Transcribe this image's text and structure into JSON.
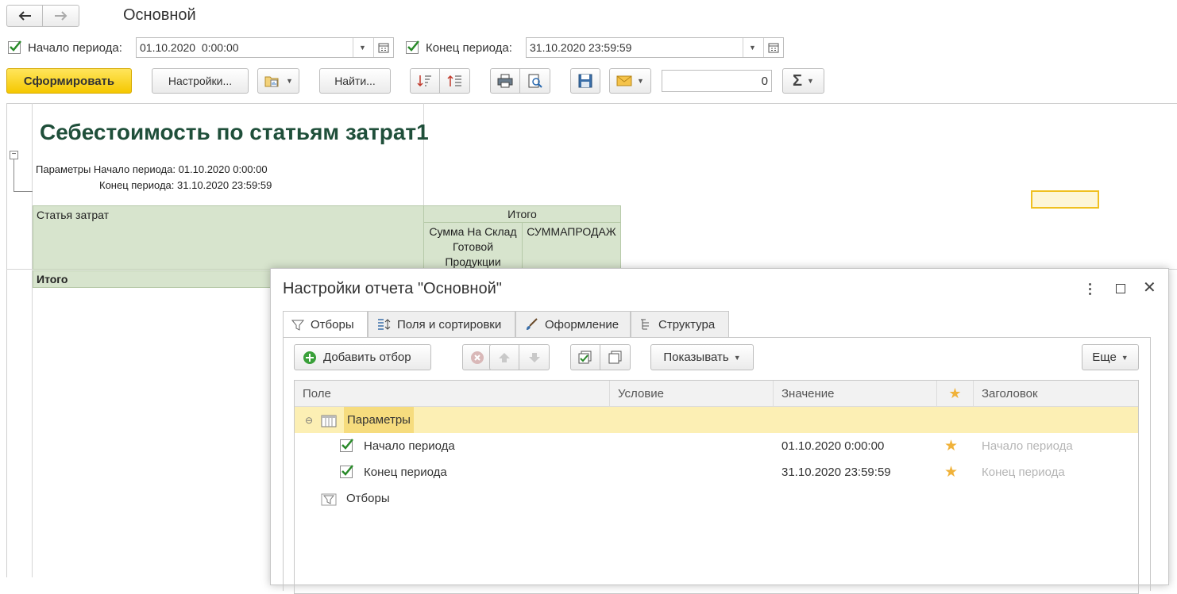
{
  "window": {
    "title": "Основной"
  },
  "nav": {
    "back_icon": "arrow-left-icon",
    "forward_icon": "arrow-right-icon"
  },
  "period": {
    "start_label": "Начало периода:",
    "start_value": "01.10.2020  0:00:00",
    "end_label": "Конец периода:",
    "end_value": "31.10.2020 23:59:59"
  },
  "toolbar": {
    "generate_label": "Сформировать",
    "settings_label": "Настройки...",
    "find_label": "Найти...",
    "sum_value": "0",
    "sum_icon": "sigma-icon"
  },
  "report": {
    "title": "Себестоимость по статьям затрат1",
    "params_line1": "Параметры Начало периода: 01.10.2020 0:00:00",
    "params_line2": "Конец периода: 31.10.2020 23:59:59",
    "col_article": "Статья затрат",
    "col_total": "Итого",
    "col_sum_warehouse": "Сумма На Склад Готовой Продукции",
    "col_sum_sales": "СУММАПРОДАЖ",
    "row_total": "Итого"
  },
  "dialog": {
    "title": "Настройки отчета \"Основной\"",
    "tabs": [
      {
        "label": "Отборы",
        "icon": "filter-icon"
      },
      {
        "label": "Поля и сортировки",
        "icon": "fields-sort-icon"
      },
      {
        "label": "Оформление",
        "icon": "brush-icon"
      },
      {
        "label": "Структура",
        "icon": "structure-icon"
      }
    ],
    "toolbar": {
      "add_filter": "Добавить отбор",
      "show": "Показывать",
      "more": "Еще"
    },
    "grid": {
      "headers": {
        "field": "Поле",
        "condition": "Условие",
        "value": "Значение",
        "title": "Заголовок"
      },
      "rows": [
        {
          "field": "Параметры",
          "condition": "",
          "value": "",
          "title": ""
        },
        {
          "field": "Начало периода",
          "condition": "",
          "value": "01.10.2020 0:00:00",
          "title": "Начало периода"
        },
        {
          "field": "Конец периода",
          "condition": "",
          "value": "31.10.2020 23:59:59",
          "title": "Конец периода"
        },
        {
          "field": "Отборы",
          "condition": "",
          "value": "",
          "title": ""
        }
      ]
    }
  },
  "colors": {
    "accent_yellow": "#f5c800",
    "report_green": "#d7e4cd",
    "title_green": "#1f4f3a",
    "selection_yellow": "#fcefb4",
    "star": "#f0b23a",
    "check": "#2a8a2a"
  }
}
